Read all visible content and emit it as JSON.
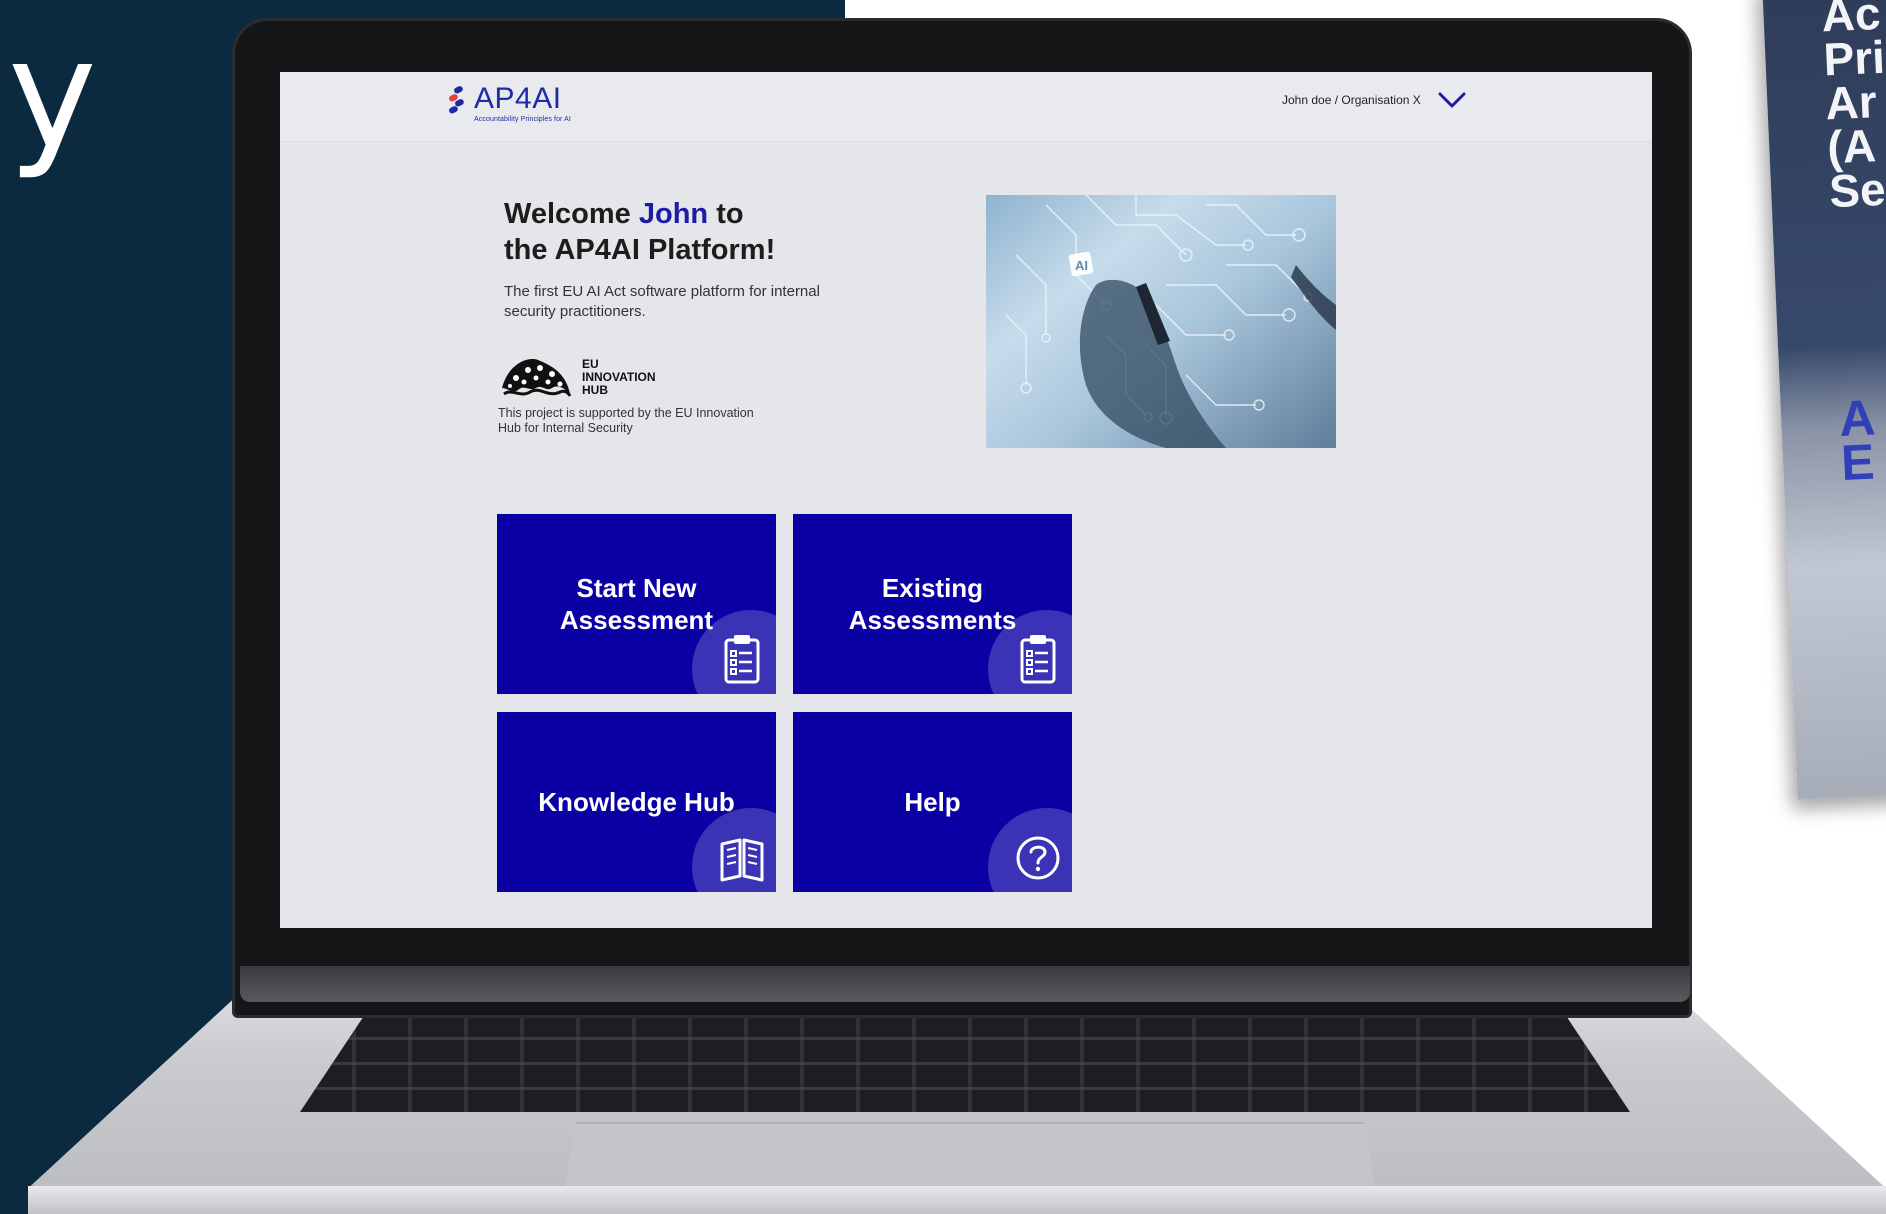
{
  "background": {
    "glyph": "y"
  },
  "brochure": {
    "lines": [
      "Ac",
      "Pri",
      "Ar",
      "(A",
      "Se"
    ],
    "lower_lines": [
      "A",
      "E"
    ]
  },
  "app": {
    "logo": {
      "text": "AP4AI",
      "tagline": "Accountability Principles for AI"
    },
    "user_menu": {
      "label": "John doe / Organisation X",
      "icon": "chevron-down-icon"
    },
    "welcome": {
      "prefix": "Welcome ",
      "name": "John",
      "suffix_1": " to",
      "line_2": "the AP4AI Platform!"
    },
    "subtitle": "The first EU AI Act software platform for internal security practitioners.",
    "partner": {
      "name_lines": [
        "EU",
        "INNOVATION",
        "HUB"
      ],
      "caption": "This project is supported by the EU Innovation Hub for Internal Security"
    },
    "hero_image_label": "AI",
    "tiles": [
      {
        "label_1": "Start New",
        "label_2": "Assessment",
        "icon": "clipboard-icon"
      },
      {
        "label_1": "Existing",
        "label_2": "Assessments",
        "icon": "clipboard-icon"
      },
      {
        "label_1": "Knowledge Hub",
        "label_2": "",
        "icon": "open-book-icon"
      },
      {
        "label_1": "Help",
        "label_2": "",
        "icon": "question-circle-icon"
      }
    ],
    "colors": {
      "primary": "#0b00a3",
      "accent_name": "#1c1ca6",
      "logo": "#1f2aa8"
    }
  }
}
